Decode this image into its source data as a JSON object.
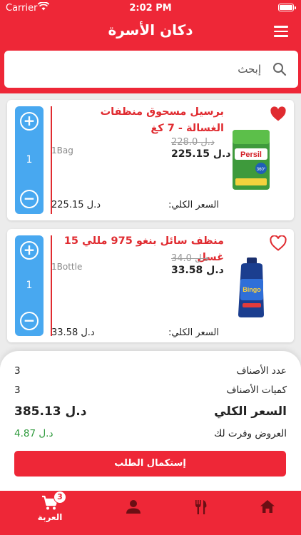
{
  "status_bar": {
    "carrier": "Carrier",
    "time": "2:02 PM"
  },
  "header": {
    "title": "دكان الأسرة",
    "menu_icon": "hamburger-icon"
  },
  "search": {
    "placeholder": "إبحث",
    "value": ""
  },
  "products": [
    {
      "title": "برسيل مسحوق منظفات الغسالة - 7 كغ",
      "old_price": "228.0 د.ل",
      "new_price": "225.15 د.ل",
      "unit": "1Bag",
      "quantity": "1",
      "total_label": "السعر الكلي:",
      "total_value": "225.15 د.ل",
      "favorite": true,
      "image_label": "Persil"
    },
    {
      "title": "منظف سائل بنغو 975 مللي 15 غسل",
      "old_price": "34.0 د.ل",
      "new_price": "33.58 د.ل",
      "unit": "1Bottle",
      "quantity": "1",
      "total_label": "السعر الكلي:",
      "total_value": "33.58 د.ل",
      "favorite": false,
      "image_label": "Bingo"
    }
  ],
  "summary": {
    "items_count_label": "عدد الأصناف",
    "items_count": "3",
    "quantities_label": "كميات الأصناف",
    "quantities": "3",
    "total_label": "السعر الكلي",
    "total": "385.13 د.ل",
    "savings_label": "العروض وفرت لك",
    "savings": "4.87 د.ل",
    "checkout_label": "إستكمال الطلب"
  },
  "tabbar": {
    "cart_label": "العربة",
    "cart_badge": "3"
  },
  "colors": {
    "primary": "#ee2737",
    "stepper": "#48a8f0",
    "savings": "#2e9a3c"
  }
}
